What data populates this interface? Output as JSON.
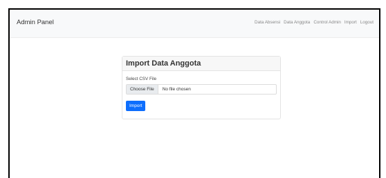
{
  "navbar": {
    "brand": "Admin Panel",
    "links": [
      "Data Absensi",
      "Data Anggota",
      "Control Admin",
      "Import",
      "Logout"
    ]
  },
  "card": {
    "title": "Import Data Anggota",
    "file_label": "Select CSV File",
    "choose_file_label": "Choose File",
    "no_file_text": "No file chosen",
    "import_button_label": "Import"
  },
  "colors": {
    "navbar_bg": "#f8f9fa",
    "primary": "#0d6efd"
  }
}
